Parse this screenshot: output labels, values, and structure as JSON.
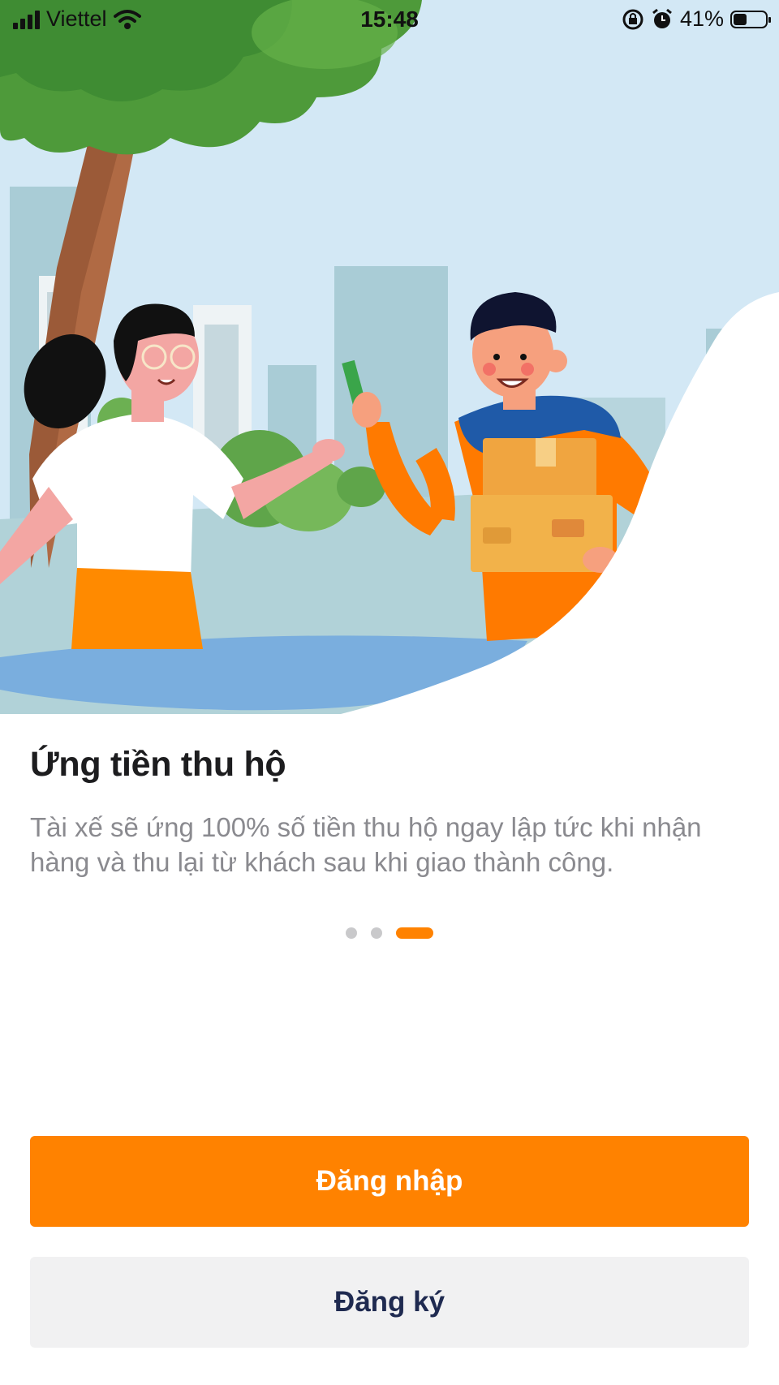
{
  "status_bar": {
    "carrier": "Viettel",
    "time": "15:48",
    "battery_percent": "41%",
    "battery_level": 0.41,
    "icons": [
      "signal-icon",
      "wifi-icon",
      "orientation-lock-icon",
      "alarm-icon",
      "battery-icon"
    ]
  },
  "onboarding": {
    "illustration": "courier-delivering-package-illustration",
    "title": "Ứng tiền thu hộ",
    "description": "Tài xế sẽ ứng 100% số tiền thu hộ ngay lập tức khi nhận hàng và thu lại từ khách sau khi giao thành công.",
    "pager": {
      "total": 3,
      "active_index": 2
    }
  },
  "actions": {
    "login_label": "Đăng nhập",
    "register_label": "Đăng ký"
  },
  "colors": {
    "accent": "#ff8200",
    "secondary_button_bg": "#f1f1f2",
    "secondary_button_text": "#1f2a50",
    "title_text": "#1d1d1f",
    "body_text": "#8a8a8f"
  }
}
